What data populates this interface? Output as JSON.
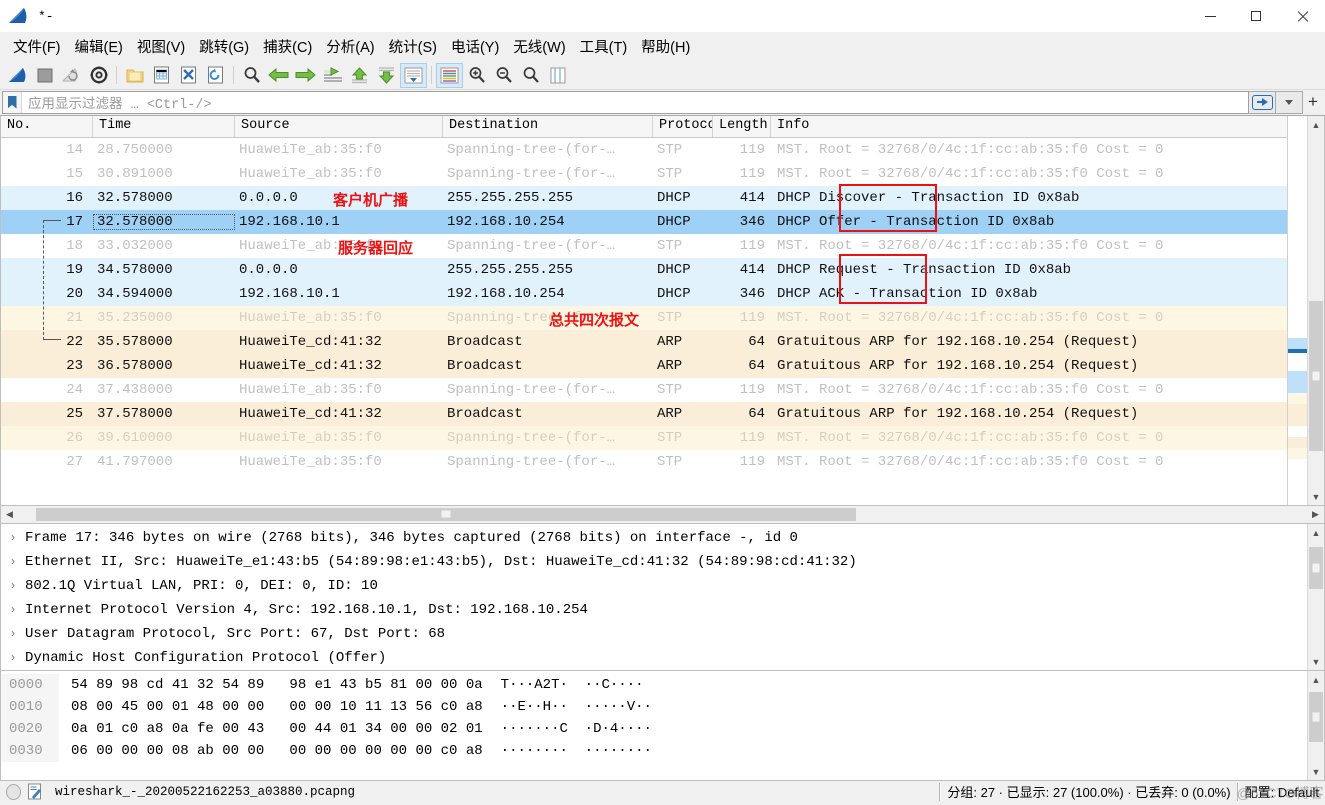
{
  "window": {
    "title": "*-",
    "icon": "wireshark-fin-icon",
    "minimize_label": "minimize",
    "maximize_label": "maximize",
    "close_label": "close"
  },
  "menubar": {
    "items": [
      {
        "label": "文件(F)",
        "name": "menu-file"
      },
      {
        "label": "编辑(E)",
        "name": "menu-edit"
      },
      {
        "label": "视图(V)",
        "name": "menu-view"
      },
      {
        "label": "跳转(G)",
        "name": "menu-go"
      },
      {
        "label": "捕获(C)",
        "name": "menu-capture"
      },
      {
        "label": "分析(A)",
        "name": "menu-analyze"
      },
      {
        "label": "统计(S)",
        "name": "menu-statistics"
      },
      {
        "label": "电话(Y)",
        "name": "menu-telephony"
      },
      {
        "label": "无线(W)",
        "name": "menu-wireless"
      },
      {
        "label": "工具(T)",
        "name": "menu-tools"
      },
      {
        "label": "帮助(H)",
        "name": "menu-help"
      }
    ]
  },
  "toolbar": {
    "buttons": [
      {
        "name": "start-capture-icon",
        "kind": "fin"
      },
      {
        "name": "stop-capture-icon",
        "kind": "stop"
      },
      {
        "name": "restart-capture-icon",
        "kind": "restart"
      },
      {
        "name": "capture-options-icon",
        "kind": "gear"
      },
      {
        "sep": true
      },
      {
        "name": "open-file-icon",
        "kind": "folder"
      },
      {
        "name": "save-file-icon",
        "kind": "save"
      },
      {
        "name": "close-file-icon",
        "kind": "closefile"
      },
      {
        "name": "reload-file-icon",
        "kind": "reload"
      },
      {
        "sep": true
      },
      {
        "name": "find-packet-icon",
        "kind": "magnifier"
      },
      {
        "name": "go-back-icon",
        "kind": "arrow-left"
      },
      {
        "name": "go-forward-icon",
        "kind": "arrow-right"
      },
      {
        "name": "go-to-packet-icon",
        "kind": "goto"
      },
      {
        "name": "go-first-packet-icon",
        "kind": "first"
      },
      {
        "name": "go-last-packet-icon",
        "kind": "last"
      },
      {
        "name": "autoscroll-icon",
        "kind": "autoscroll",
        "active": true
      },
      {
        "sep": true
      },
      {
        "name": "colorize-icon",
        "kind": "colorize",
        "active": true
      },
      {
        "name": "zoom-in-icon",
        "kind": "zoom-in"
      },
      {
        "name": "zoom-out-icon",
        "kind": "zoom-out"
      },
      {
        "name": "zoom-reset-icon",
        "kind": "zoom-reset"
      },
      {
        "name": "resize-columns-icon",
        "kind": "resize"
      }
    ]
  },
  "filterbar": {
    "bookmark_icon": "bookmark-icon",
    "placeholder": "应用显示过滤器 … <Ctrl-/>",
    "apply_icon": "apply-filter-arrow-icon",
    "dropdown_icon": "chevron-down-icon",
    "add_icon": "plus-icon"
  },
  "packet_list": {
    "columns": [
      "No.",
      "Time",
      "Source",
      "Destination",
      "Protocol",
      "Length",
      "Info"
    ],
    "selected_no": "17",
    "rows": [
      {
        "no": "14",
        "time": "28.750000",
        "src": "HuaweiTe_ab:35:f0",
        "dst": "Spanning-tree-(for-…",
        "proto": "STP",
        "len": "119",
        "info": "MST. Root = 32768/0/4c:1f:cc:ab:35:f0  Cost = 0",
        "style": "stp"
      },
      {
        "no": "15",
        "time": "30.891000",
        "src": "HuaweiTe_ab:35:f0",
        "dst": "Spanning-tree-(for-…",
        "proto": "STP",
        "len": "119",
        "info": "MST. Root = 32768/0/4c:1f:cc:ab:35:f0  Cost = 0",
        "style": "stp"
      },
      {
        "no": "16",
        "time": "32.578000",
        "src": "0.0.0.0",
        "dst": "255.255.255.255",
        "proto": "DHCP",
        "len": "414",
        "info": "DHCP Discover - Transaction ID 0x8ab",
        "style": "dhcp"
      },
      {
        "no": "17",
        "time": "32.578000",
        "src": "192.168.10.1",
        "dst": "192.168.10.254",
        "proto": "DHCP",
        "len": "346",
        "info": "DHCP Offer    - Transaction ID 0x8ab",
        "style": "dhcp-selected"
      },
      {
        "no": "18",
        "time": "33.032000",
        "src": "HuaweiTe_ab:35:f0",
        "dst": "Spanning-tree-(for-…",
        "proto": "STP",
        "len": "119",
        "info": "MST. Root = 32768/0/4c:1f:cc:ab:35:f0  Cost = 0",
        "style": "stp"
      },
      {
        "no": "19",
        "time": "34.578000",
        "src": "0.0.0.0",
        "dst": "255.255.255.255",
        "proto": "DHCP",
        "len": "414",
        "info": "DHCP Request  - Transaction ID 0x8ab",
        "style": "dhcp"
      },
      {
        "no": "20",
        "time": "34.594000",
        "src": "192.168.10.1",
        "dst": "192.168.10.254",
        "proto": "DHCP",
        "len": "346",
        "info": "DHCP ACK      - Transaction ID 0x8ab",
        "style": "dhcp"
      },
      {
        "no": "21",
        "time": "35.235000",
        "src": "HuaweiTe_ab:35:f0",
        "dst": "Spanning-tree-(for-…",
        "proto": "STP",
        "len": "119",
        "info": "MST. Root = 32768/0/4c:1f:cc:ab:35:f0  Cost = 0",
        "style": "stp-alt"
      },
      {
        "no": "22",
        "time": "35.578000",
        "src": "HuaweiTe_cd:41:32",
        "dst": "Broadcast",
        "proto": "ARP",
        "len": "64",
        "info": "Gratuitous ARP for 192.168.10.254 (Request)",
        "style": "arp"
      },
      {
        "no": "23",
        "time": "36.578000",
        "src": "HuaweiTe_cd:41:32",
        "dst": "Broadcast",
        "proto": "ARP",
        "len": "64",
        "info": "Gratuitous ARP for 192.168.10.254 (Request)",
        "style": "arp"
      },
      {
        "no": "24",
        "time": "37.438000",
        "src": "HuaweiTe_ab:35:f0",
        "dst": "Spanning-tree-(for-…",
        "proto": "STP",
        "len": "119",
        "info": "MST. Root = 32768/0/4c:1f:cc:ab:35:f0  Cost = 0",
        "style": "stp"
      },
      {
        "no": "25",
        "time": "37.578000",
        "src": "HuaweiTe_cd:41:32",
        "dst": "Broadcast",
        "proto": "ARP",
        "len": "64",
        "info": "Gratuitous ARP for 192.168.10.254 (Request)",
        "style": "arp"
      },
      {
        "no": "26",
        "time": "39.610000",
        "src": "HuaweiTe_ab:35:f0",
        "dst": "Spanning-tree-(for-…",
        "proto": "STP",
        "len": "119",
        "info": "MST. Root = 32768/0/4c:1f:cc:ab:35:f0  Cost = 0",
        "style": "stp-alt"
      },
      {
        "no": "27",
        "time": "41.797000",
        "src": "HuaweiTe_ab:35:f0",
        "dst": "Spanning-tree-(for-…",
        "proto": "STP",
        "len": "119",
        "info": "MST. Root = 32768/0/4c:1f:cc:ab:35:f0  Cost = 0",
        "style": "stp"
      }
    ]
  },
  "annotations": [
    {
      "name": "annotation-client-broadcast",
      "text": "客户机广播",
      "color": "#ee1111"
    },
    {
      "name": "annotation-server-reply",
      "text": "服务器回应",
      "color": "#ee1111"
    },
    {
      "name": "annotation-four-packets",
      "text": "总共四次报文",
      "color": "#ee1111"
    },
    {
      "name": "annotation-box-discover-offer",
      "text": "",
      "color": "#ee1111"
    },
    {
      "name": "annotation-box-request-ack",
      "text": "",
      "color": "#ee1111"
    }
  ],
  "packet_detail": {
    "rows": [
      {
        "twisty": "›",
        "text": "Frame 17: 346 bytes on wire (2768 bits), 346 bytes captured (2768 bits) on interface -, id 0"
      },
      {
        "twisty": "›",
        "text": "Ethernet II, Src: HuaweiTe_e1:43:b5 (54:89:98:e1:43:b5), Dst: HuaweiTe_cd:41:32 (54:89:98:cd:41:32)"
      },
      {
        "twisty": "›",
        "text": "802.1Q Virtual LAN, PRI: 0, DEI: 0, ID: 10"
      },
      {
        "twisty": "›",
        "text": "Internet Protocol Version 4, Src: 192.168.10.1, Dst: 192.168.10.254"
      },
      {
        "twisty": "›",
        "text": "User Datagram Protocol, Src Port: 67, Dst Port: 68"
      },
      {
        "twisty": "›",
        "text": "Dynamic Host Configuration Protocol (Offer)"
      }
    ]
  },
  "hex_dump": {
    "rows": [
      {
        "offset": "0000",
        "hex": "54 89 98 cd 41 32 54 89   98 e1 43 b5 81 00 00 0a",
        "ascii": "T···A2T·  ··C····"
      },
      {
        "offset": "0010",
        "hex": "08 00 45 00 01 48 00 00   00 00 10 11 13 56 c0 a8",
        "ascii": "··E··H··  ·····V··"
      },
      {
        "offset": "0020",
        "hex": "0a 01 c0 a8 0a fe 00 43   00 44 01 34 00 00 02 01",
        "ascii": "·······C  ·D·4····"
      },
      {
        "offset": "0030",
        "hex": "06 00 00 00 08 ab 00 00   00 00 00 00 00 00 c0 a8",
        "ascii": "········  ········"
      }
    ]
  },
  "statusbar": {
    "expert_icon": "expert-info-icon",
    "capture_file_icon": "capture-file-properties-icon",
    "filename": "wireshark_-_20200522162253_a03880.pcapng",
    "counts": "分组: 27 · 已显示: 27 (100.0%) · 已丢弃: 0 (0.0%)",
    "profile": "配置: Default",
    "watermark": "@51CTO博客"
  },
  "colors": {
    "dhcp_row": "#e2f2fd",
    "dhcp_selected_row": "#9fd0f5",
    "arp_row": "#fbeed8",
    "stp_row": "#ffffff",
    "annotation_red": "#ee1111",
    "accent_blue": "#1e6fc4"
  }
}
